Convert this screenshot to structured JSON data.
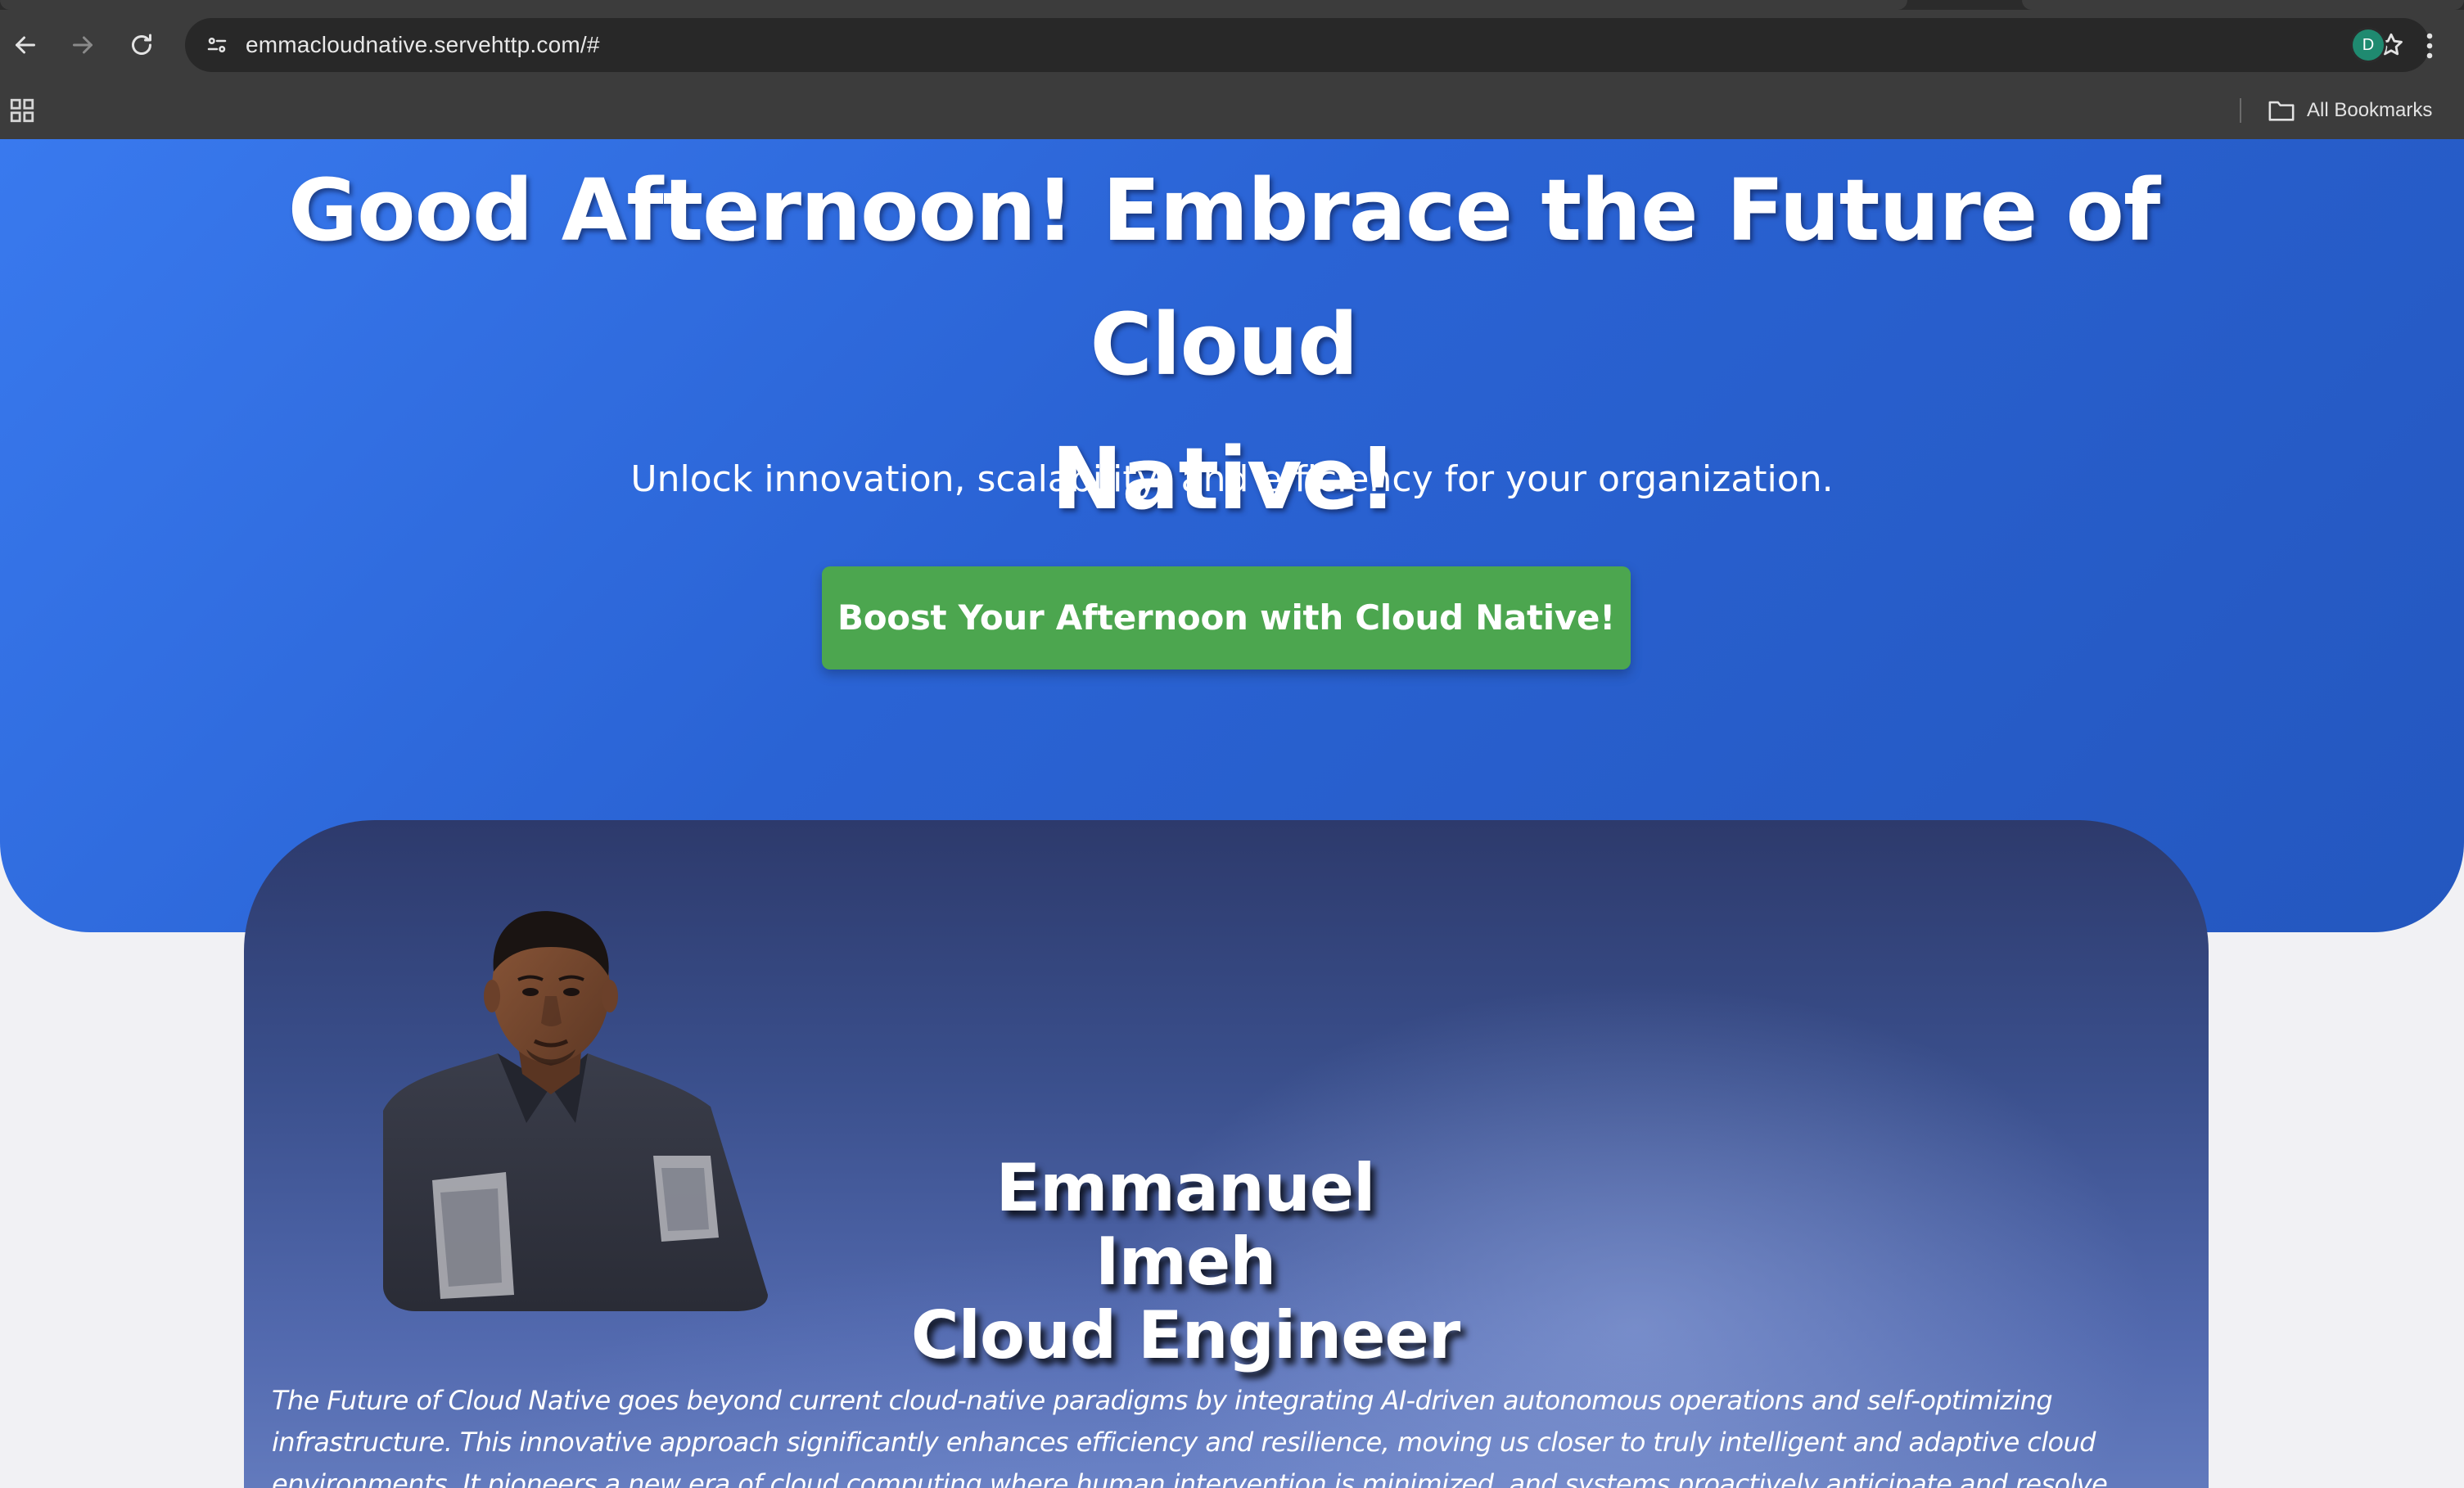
{
  "browser": {
    "url": "emmacloudnative.servehttp.com/#",
    "profile_initial": "D",
    "bookmarks_label": "All Bookmarks",
    "icons": {
      "back": "back-arrow-icon",
      "forward": "forward-arrow-icon",
      "reload": "reload-icon",
      "site_info": "site-info-icon",
      "bookmark": "star-icon",
      "menu": "kebab-menu-icon",
      "apps": "apps-grid-icon",
      "folder": "folder-icon"
    }
  },
  "hero": {
    "title_line1": "Good Afternoon! Embrace the Future of Cloud",
    "title_line2": "Native!",
    "subtitle": "Unlock innovation, scalability, and efficiency for your organization.",
    "cta_label": "Boost Your Afternoon with Cloud Native!"
  },
  "profile": {
    "name": "Emmanuel Imeh",
    "role": "Cloud Engineer",
    "description": "The Future of Cloud Native goes beyond current cloud-native paradigms by integrating AI-driven autonomous operations and self-optimizing infrastructure. This innovative approach significantly enhances efficiency and resilience, moving us closer to truly intelligent and adaptive cloud environments. It pioneers a new era of cloud computing where human intervention is minimized, and systems proactively anticipate and resolve issues."
  },
  "colors": {
    "hero_bg": "#2a63d4",
    "cta_bg": "#4ca64f",
    "card_bg": "#3a4f8c",
    "page_bg": "#f1f1f4",
    "chrome_bg": "#3c3c3c",
    "avatar_bg": "#1f8a70"
  }
}
